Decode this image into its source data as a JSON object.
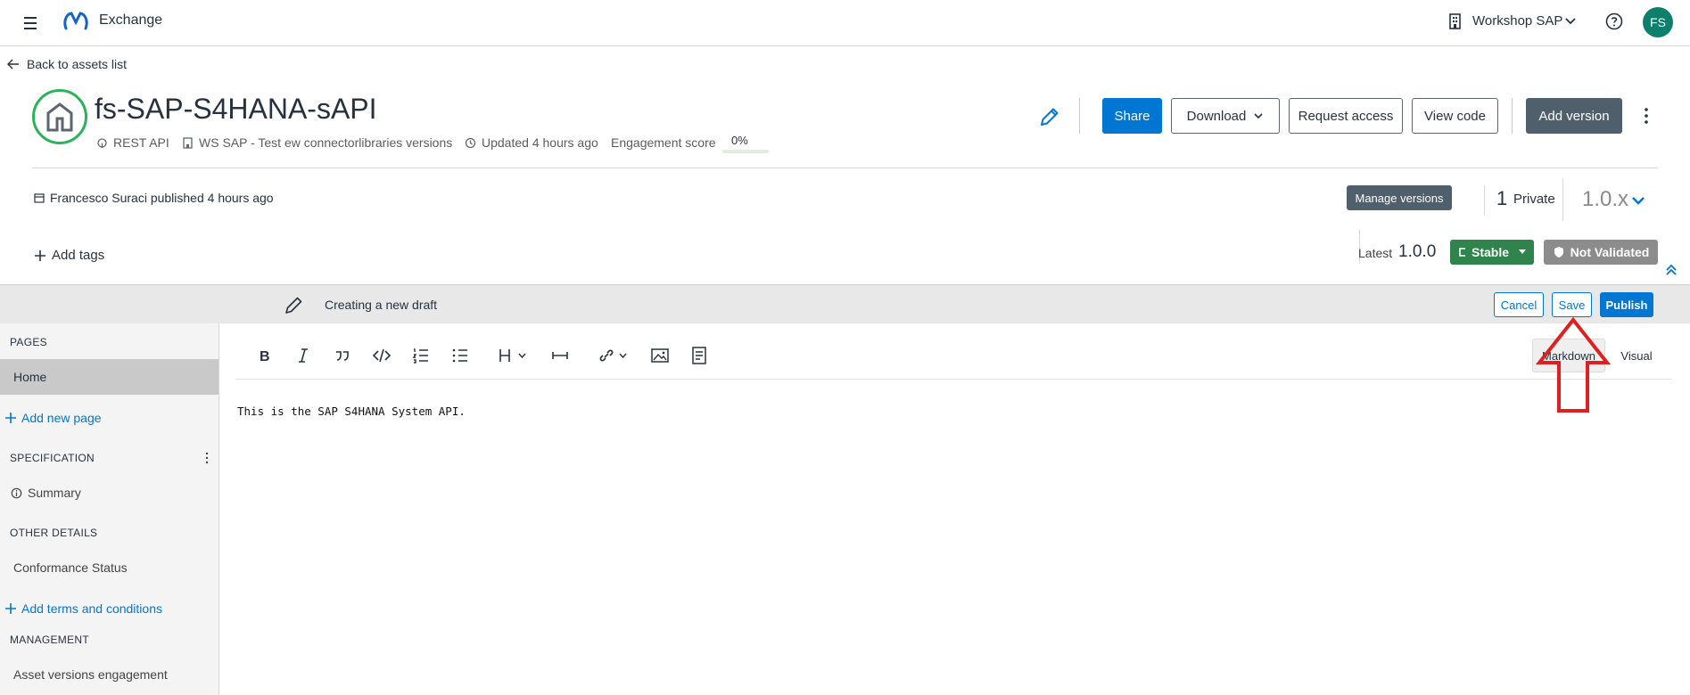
{
  "topbar": {
    "menu_icon": "hamburger-icon",
    "app_name": "Exchange",
    "org_name": "Workshop SAP",
    "avatar_initials": "FS"
  },
  "back_link": "Back to assets list",
  "asset": {
    "title": "fs-SAP-S4HANA-sAPI",
    "type": "REST API",
    "business_group": "WS SAP - Test ew connectorlibraries versions",
    "updated": "Updated 4 hours ago",
    "engagement_label": "Engagement score",
    "engagement_value": "0%",
    "engagement_fraction": 0,
    "icon_color": "#2bb35a"
  },
  "actions": {
    "share": "Share",
    "download": "Download",
    "request_access": "Request access",
    "view_code": "View code",
    "add_version": "Add version"
  },
  "publish_info": "Francesco Suraci published 4 hours ago",
  "versions": {
    "manage": "Manage versions",
    "private_count": "1",
    "private_label": "Private",
    "selected": "1.0.x",
    "latest_label": "Latest",
    "latest_value": "1.0.0",
    "stable": "Stable",
    "not_validated": "Not Validated"
  },
  "add_tags": "Add tags",
  "draft": {
    "text": "Creating a new draft",
    "cancel": "Cancel",
    "save": "Save",
    "publish": "Publish"
  },
  "sidebar": {
    "pages_header": "PAGES",
    "home": "Home",
    "add_page": "Add new page",
    "spec_header": "SPECIFICATION",
    "summary": "Summary",
    "other_header": "OTHER DETAILS",
    "conformance": "Conformance Status",
    "add_terms": "Add terms and conditions",
    "management_header": "MANAGEMENT",
    "asset_engagement": "Asset versions engagement"
  },
  "editor": {
    "tab_markdown": "Markdown",
    "tab_visual": "Visual",
    "content": "This is the SAP S4HANA System API."
  },
  "colors": {
    "primary": "#0176d3",
    "dark_button": "#4f5f6c",
    "stable": "#2e844a",
    "not_validated": "#8c8c8c",
    "annotation": "#e02020"
  }
}
